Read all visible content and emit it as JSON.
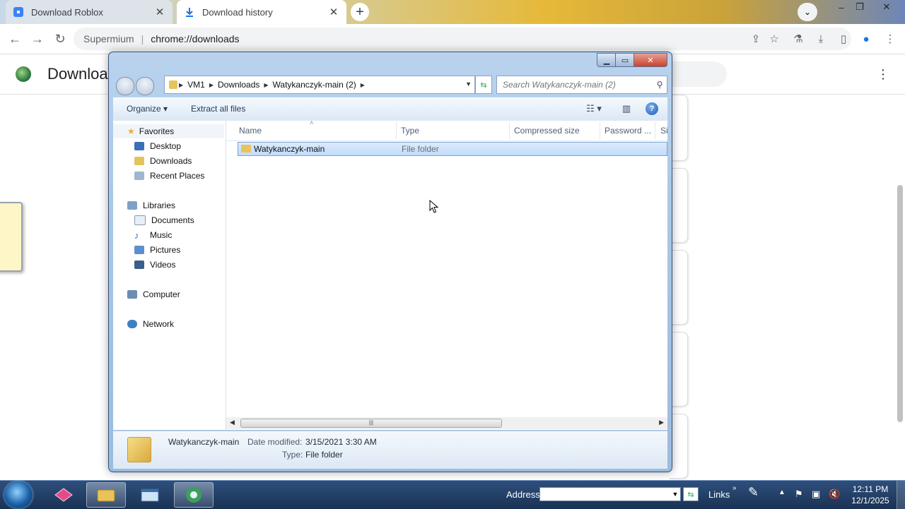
{
  "browser": {
    "tabs": [
      {
        "label": "Download Roblox",
        "close": "✕"
      },
      {
        "label": "Download history",
        "close": "✕"
      }
    ],
    "new_tab": "+",
    "omnibox": {
      "site": "Supermium",
      "url": "chrome://downloads"
    },
    "page_title": "Downloa"
  },
  "explorer": {
    "breadcrumb": [
      "VM1",
      "Downloads",
      "Watykanczyk-main (2)"
    ],
    "search_placeholder": "Search Watykanczyk-main (2)",
    "commands": {
      "organize": "Organize",
      "extract": "Extract all files"
    },
    "nav": {
      "favorites": "Favorites",
      "favorites_items": [
        "Desktop",
        "Downloads",
        "Recent Places"
      ],
      "libraries": "Libraries",
      "libraries_items": [
        "Documents",
        "Music",
        "Pictures",
        "Videos"
      ],
      "computer": "Computer",
      "network": "Network"
    },
    "columns": [
      "Name",
      "Type",
      "Compressed size",
      "Password ...",
      "Si"
    ],
    "files": [
      {
        "name": "Watykanczyk-main",
        "type": "File folder"
      }
    ],
    "details": {
      "name": "Watykanczyk-main",
      "date_label": "Date modified:",
      "date_value": "3/15/2021 3:30 AM",
      "type_label": "Type:",
      "type_value": "File folder"
    }
  },
  "taskbar": {
    "address_label": "Address",
    "links_label": "Links",
    "time": "12:11 PM",
    "date": "12/1/2025"
  }
}
